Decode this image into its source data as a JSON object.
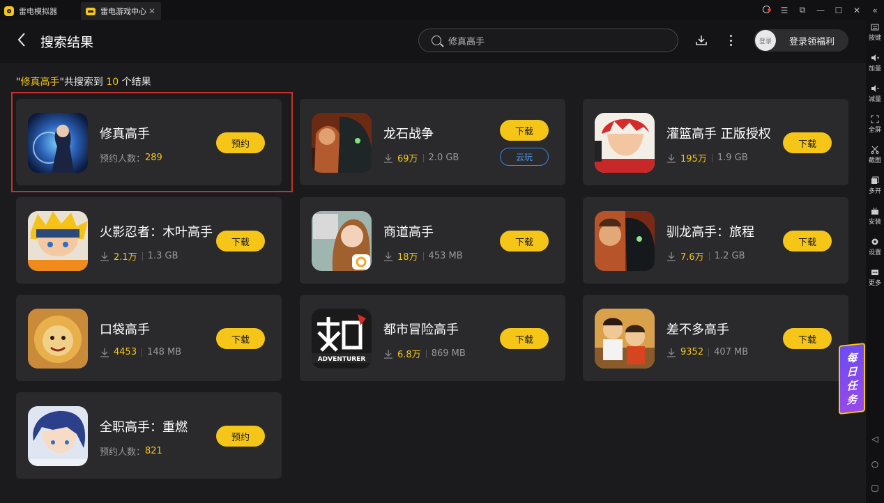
{
  "titlebar": {
    "tabs": [
      {
        "label": "雷电模拟器"
      },
      {
        "label": "雷电游戏中心",
        "close": "✕"
      }
    ]
  },
  "header": {
    "title": "搜索结果",
    "search": {
      "value": "修真高手"
    },
    "login": {
      "avatar_text": "登录",
      "label": "登录领福利"
    }
  },
  "summary": {
    "q_open": "\"",
    "query": "修真高手",
    "q_close": "\"",
    "text1": "共搜索到 ",
    "count": "10",
    "text2": " 个结果"
  },
  "results": [
    {
      "name": "修真高手",
      "meta_label": "预约人数：",
      "meta_value": "289",
      "button": "预约"
    },
    {
      "name": "龙石战争",
      "downloads": "69万",
      "size": "2.0 GB",
      "button": "下载",
      "cloud_button": "云玩"
    },
    {
      "name": "灌篮高手 正版授权",
      "downloads": "195万",
      "size": "1.9 GB",
      "button": "下载"
    },
    {
      "name": "火影忍者：木叶高手",
      "downloads": "2.1万",
      "size": "1.3 GB",
      "button": "下载"
    },
    {
      "name": "商道高手",
      "downloads": "18万",
      "size": "453 MB",
      "button": "下载"
    },
    {
      "name": "驯龙高手：旅程",
      "downloads": "7.6万",
      "size": "1.2 GB",
      "button": "下载"
    },
    {
      "name": "口袋高手",
      "downloads": "4453",
      "size": "148 MB",
      "button": "下载"
    },
    {
      "name": "都市冒险高手",
      "downloads": "6.8万",
      "size": "869 MB",
      "button": "下载"
    },
    {
      "name": "差不多高手",
      "downloads": "9352",
      "size": "407 MB",
      "button": "下载"
    },
    {
      "name": "全职高手：重燃",
      "meta_label": "预约人数：",
      "meta_value": "821",
      "button": "预约"
    }
  ],
  "sidebar": {
    "items": [
      {
        "label": "按键"
      },
      {
        "label": "加量"
      },
      {
        "label": "减量"
      },
      {
        "label": "全屏"
      },
      {
        "label": "截图"
      },
      {
        "label": "多开"
      },
      {
        "label": "安装"
      },
      {
        "label": "设置"
      },
      {
        "label": "更多"
      }
    ]
  },
  "daily_task": {
    "chars": [
      "每",
      "日",
      "任",
      "务"
    ]
  },
  "icon_art_8": "ADVENTURER",
  "colors": {
    "accent": "#f5c518",
    "card_bg": "#2a2a2d",
    "page_bg": "#1b1b1d",
    "highlight": "#c9302c",
    "cloud": "#3a86e0"
  }
}
